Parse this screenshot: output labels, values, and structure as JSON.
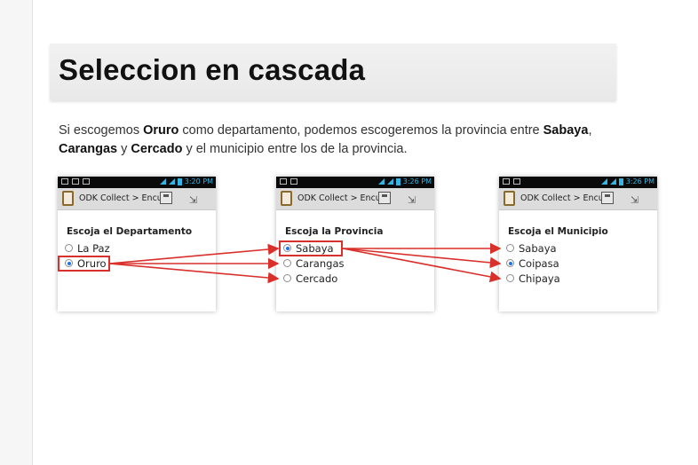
{
  "slide": {
    "title": "Seleccion en cascada",
    "desc": {
      "p1": "Si escogemos ",
      "b1": "Oruro",
      "p2": " como departamento, podemos escogeremos la provincia entre ",
      "b2": "Sabaya",
      "p3": ", ",
      "b3": "Carangas",
      "p4": " y ",
      "b4": "Cercado",
      "p5": " y el municipio entre los de la provincia."
    }
  },
  "colors": {
    "highlight": "#d9302b",
    "status_blue": "#33b5e5",
    "radio_selected": "#1a73e8"
  },
  "phones": [
    {
      "time": "3:20",
      "ampm": "PM",
      "app_title": "ODK Collect > Encu",
      "question": "Escoja el Departamento",
      "options": [
        {
          "label": "La Paz",
          "selected": false
        },
        {
          "label": "Oruro",
          "selected": true
        }
      ]
    },
    {
      "time": "3:26",
      "ampm": "PM",
      "app_title": "ODK Collect > Encu",
      "question": "Escoja la Provincia",
      "options": [
        {
          "label": "Sabaya",
          "selected": true
        },
        {
          "label": "Carangas",
          "selected": false
        },
        {
          "label": "Cercado",
          "selected": false
        }
      ]
    },
    {
      "time": "3:26",
      "ampm": "PM",
      "app_title": "ODK Collect > Encu",
      "question": "Escoja el Municipio",
      "options": [
        {
          "label": "Sabaya",
          "selected": false
        },
        {
          "label": "Coipasa",
          "selected": true
        },
        {
          "label": "Chipaya",
          "selected": false
        }
      ]
    }
  ]
}
